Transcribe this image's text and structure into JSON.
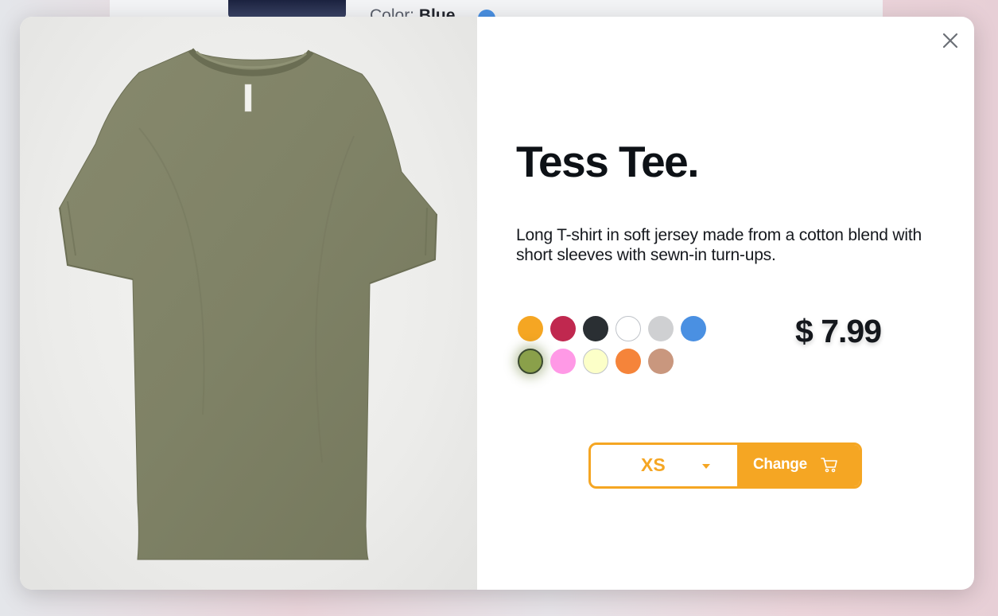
{
  "background": {
    "color_label": "Color:",
    "color_value": "Blue"
  },
  "product": {
    "title": "Tess Tee.",
    "description": "Long T-shirt in soft jersey made from a cotton blend with short sleeves with sewn-in turn-ups.",
    "price": "$ 7.99",
    "image_icon": "tshirt-image",
    "selected_color": "#8aa04a"
  },
  "colors": [
    "#f5a623",
    "#c0284f",
    "#2a2f33",
    "#ffffff",
    "#cfd0d2",
    "#4a90e2",
    "#8aa04a",
    "#ff99e6",
    "#fcffc8",
    "#f5843a",
    "#c9977e"
  ],
  "cart": {
    "size": "XS",
    "change_label": "Change",
    "accent": "#f5a623"
  },
  "icons": {
    "close": "close-icon",
    "caret": "caret-down-icon",
    "cart": "cart-icon"
  }
}
